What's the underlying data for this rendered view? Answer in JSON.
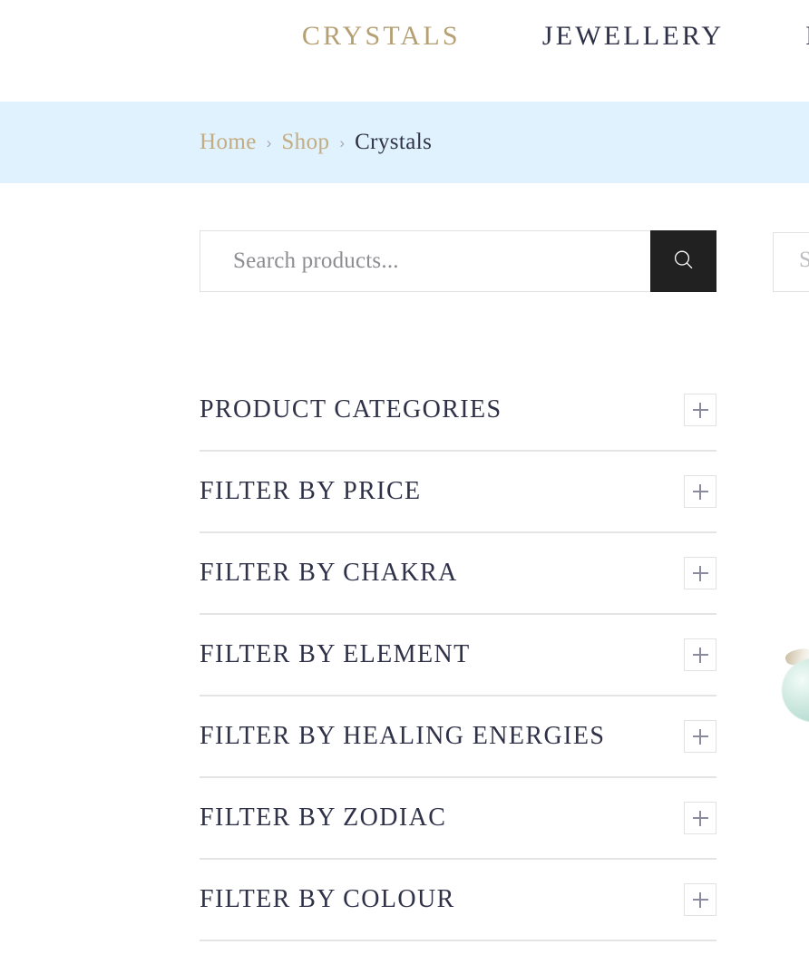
{
  "nav": {
    "items": [
      {
        "label": "CRYSTALS",
        "color": "#b5a074",
        "active": true
      },
      {
        "label": "JEWELLERY",
        "color": "#2f3148",
        "active": false
      },
      {
        "label": "HO",
        "color": "#2f3148",
        "active": false
      }
    ]
  },
  "breadcrumb": {
    "background": "#e0f2fd",
    "separator": "›",
    "items": [
      {
        "label": "Home",
        "current": false
      },
      {
        "label": "Shop",
        "current": false
      },
      {
        "label": "Crystals",
        "current": true
      }
    ]
  },
  "search": {
    "placeholder": "Search products...",
    "value": "",
    "button_icon": "search-icon",
    "button_color": "#212121"
  },
  "search_secondary": {
    "partial_text": "S",
    "placeholder": "Search..."
  },
  "product_peek": {
    "name": "crystal-sphere-thumbnail",
    "color": "#cfe9e0"
  },
  "filters": {
    "toggle_icon": "plus-icon",
    "items": [
      {
        "label": "PRODUCT CATEGORIES",
        "expanded": false
      },
      {
        "label": "FILTER BY PRICE",
        "expanded": false
      },
      {
        "label": "FILTER BY CHAKRA",
        "expanded": false
      },
      {
        "label": "FILTER BY ELEMENT",
        "expanded": false
      },
      {
        "label": "FILTER BY HEALING ENERGIES",
        "expanded": false
      },
      {
        "label": "FILTER BY ZODIAC",
        "expanded": false
      },
      {
        "label": "FILTER BY COLOUR",
        "expanded": false
      }
    ]
  },
  "colors": {
    "gold": "#b5a074",
    "dark_navy": "#2f3148",
    "breadcrumb_bg": "#e0f2fd",
    "button_dark": "#212121",
    "divider": "#e4e4e6",
    "plus": "#8b8ba0"
  }
}
